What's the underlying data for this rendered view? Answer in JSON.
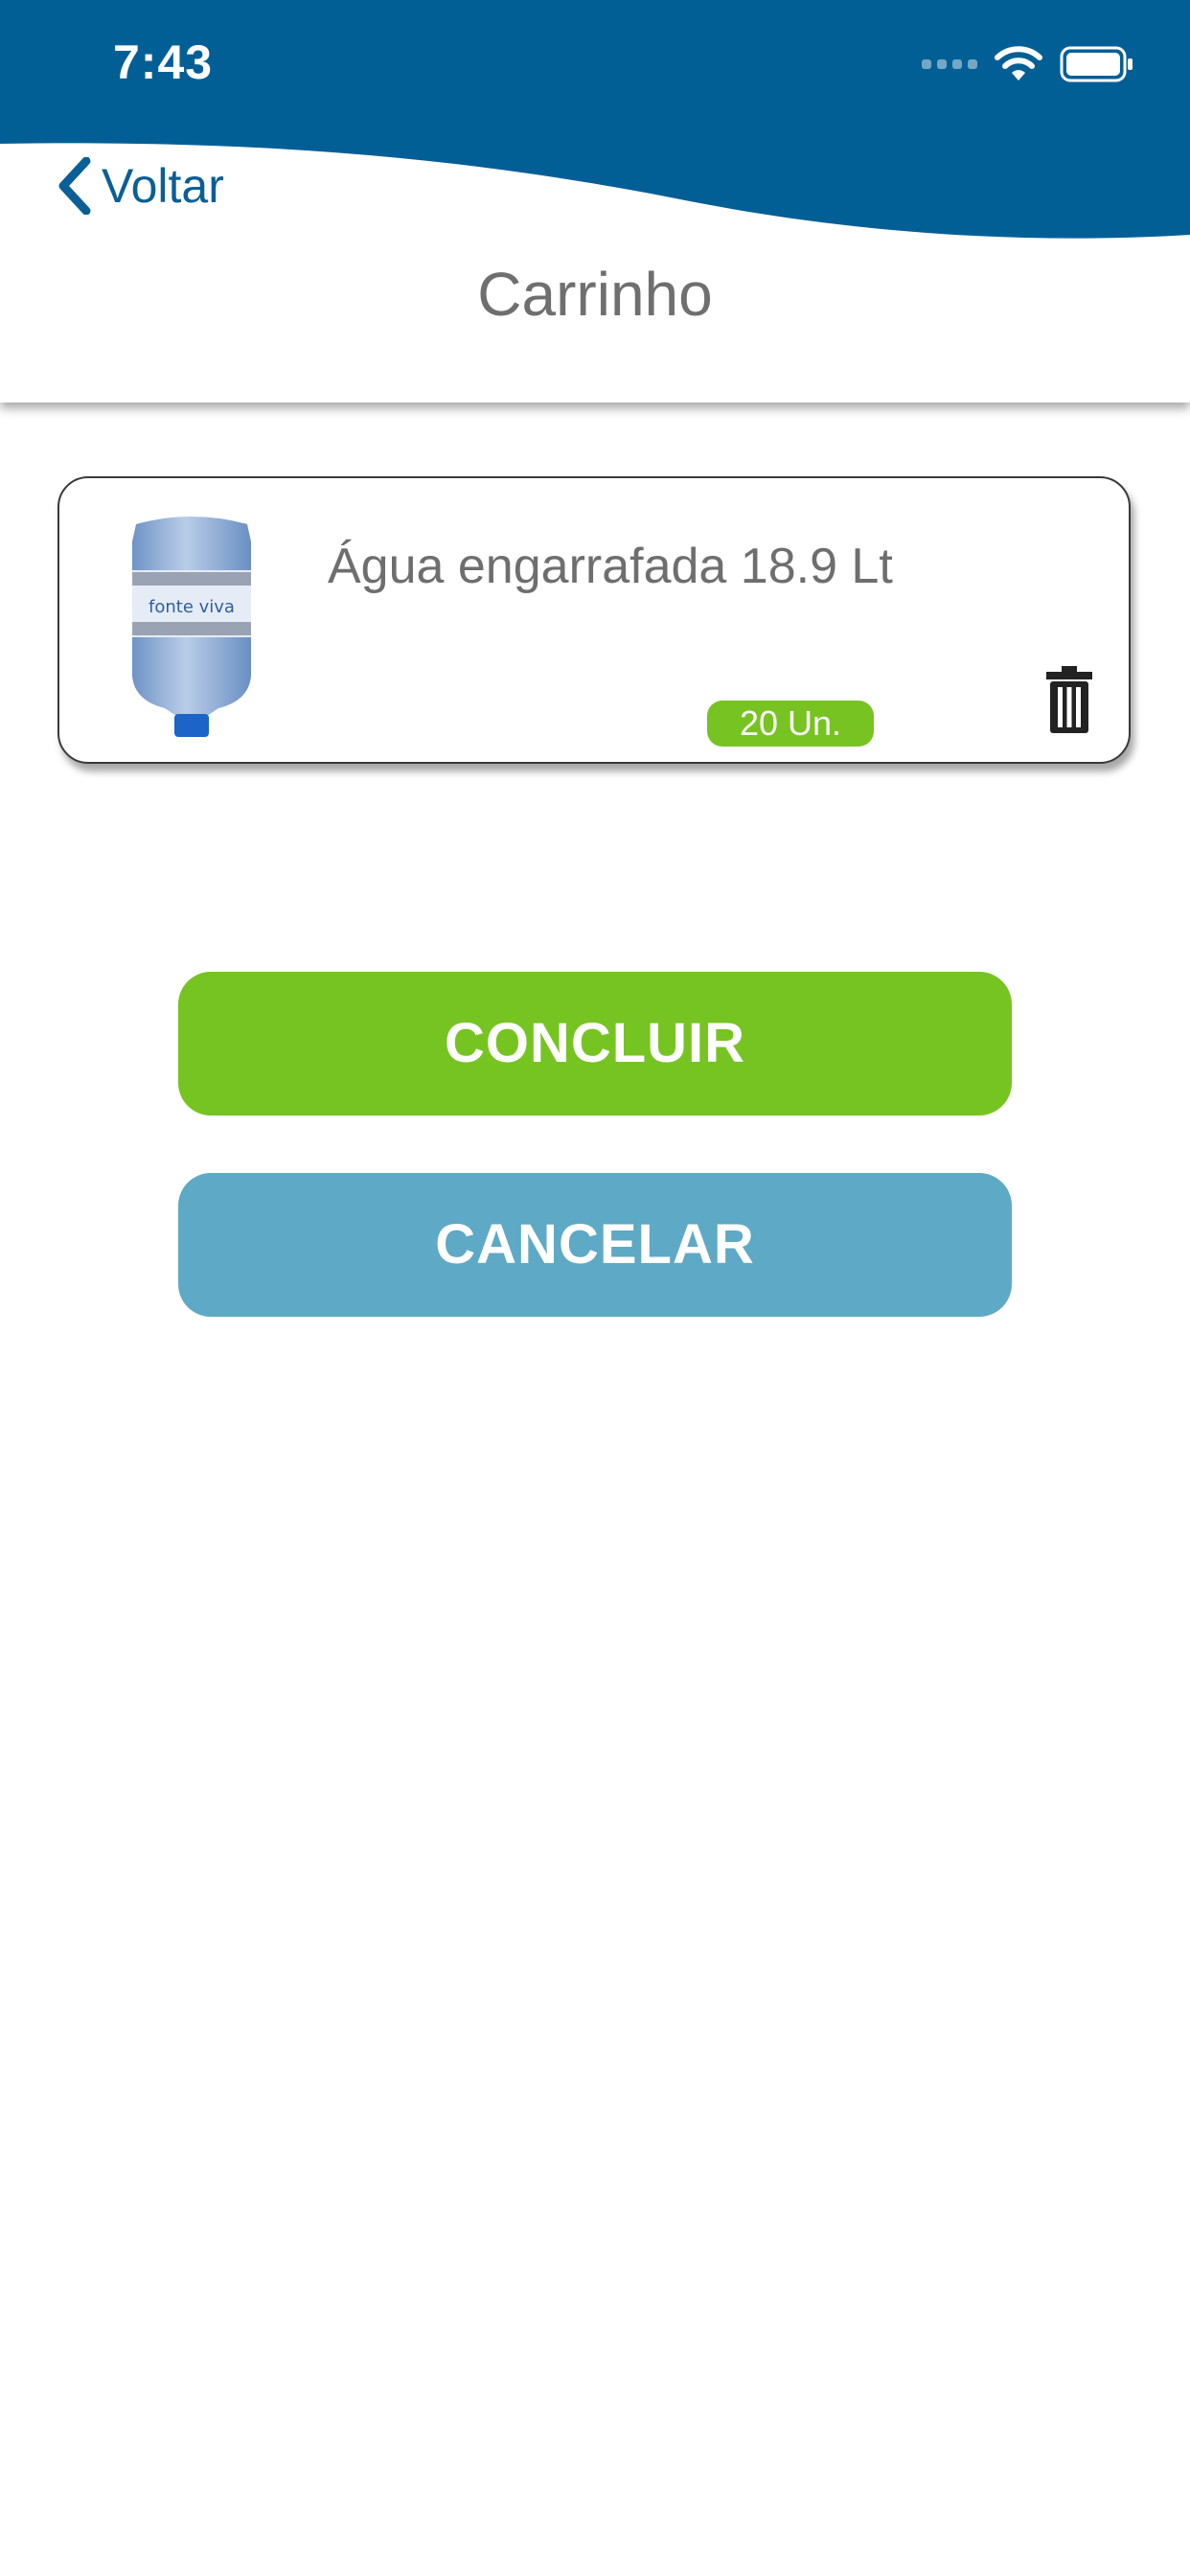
{
  "status_bar": {
    "time": "7:43"
  },
  "nav": {
    "back_label": "Voltar",
    "title": "Carrinho"
  },
  "cart": {
    "items": [
      {
        "name": "Água engarrafada 18.9 Lt",
        "quantity": "20 Un.",
        "image_brand": "fonte viva"
      }
    ]
  },
  "actions": {
    "confirm_label": "CONCLUIR",
    "cancel_label": "CANCELAR"
  },
  "colors": {
    "header_blue": "#025F96",
    "accent_green": "#76C421",
    "cancel_blue": "#5EA9C5",
    "title_gray": "#6F6F6F"
  },
  "icons": [
    "chevron-left-icon",
    "wifi-icon",
    "battery-icon",
    "trash-icon"
  ]
}
